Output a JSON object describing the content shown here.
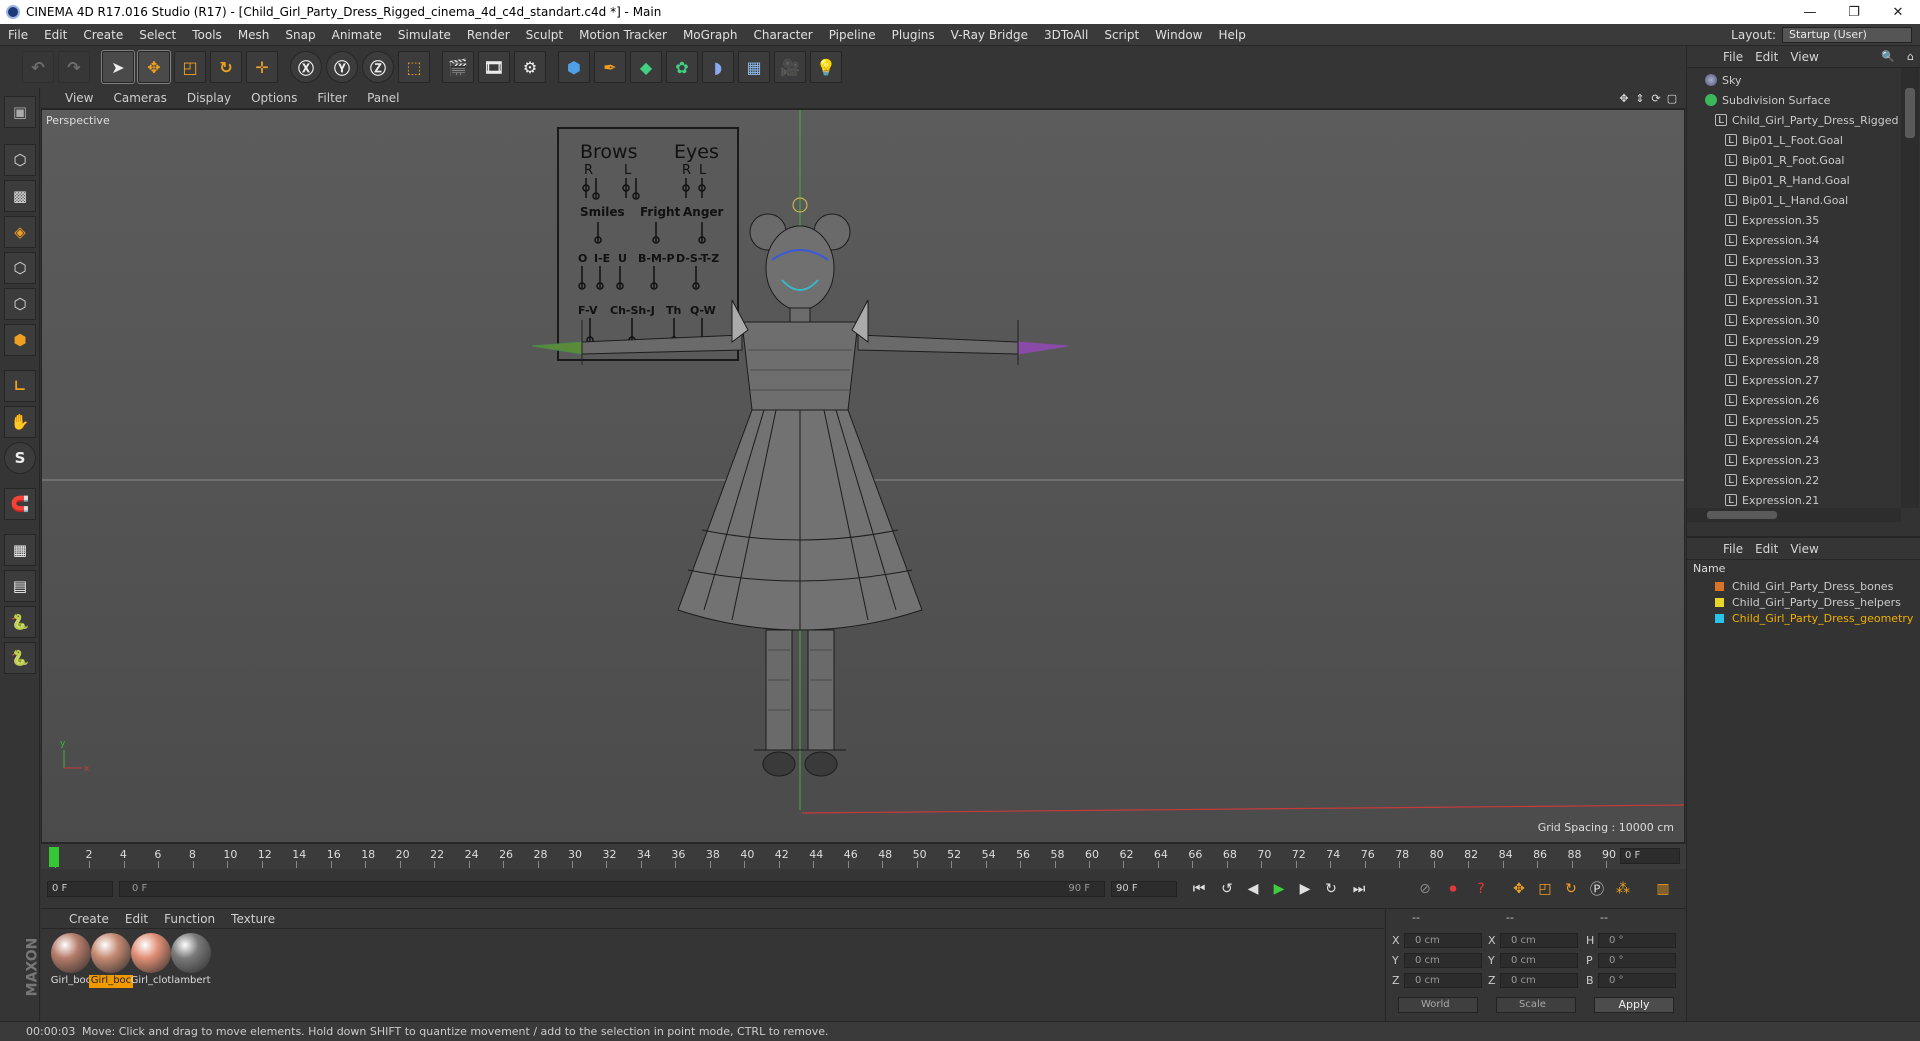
{
  "title": "CINEMA 4D R17.016 Studio (R17) - [Child_Girl_Party_Dress_Rigged_cinema_4d_c4d_standart.c4d *] - Main",
  "window_buttons": [
    "—",
    "❐",
    "✕"
  ],
  "menu": [
    "File",
    "Edit",
    "Create",
    "Select",
    "Tools",
    "Mesh",
    "Snap",
    "Animate",
    "Simulate",
    "Render",
    "Sculpt",
    "Motion Tracker",
    "MoGraph",
    "Character",
    "Pipeline",
    "Plugins",
    "V-Ray Bridge",
    "3DToAll",
    "Script",
    "Window",
    "Help"
  ],
  "layout": {
    "label": "Layout:",
    "value": "Startup (User)"
  },
  "viewport": {
    "menu": [
      "View",
      "Cameras",
      "Display",
      "Options",
      "Filter",
      "Panel"
    ],
    "label": "Perspective",
    "grid_spacing": "Grid Spacing : 10000 cm",
    "axis_y": "y",
    "axis_x": "x",
    "board": {
      "brows": "Brows",
      "eyes": "Eyes",
      "r1": "R",
      "l1": "L",
      "r2": "R",
      "l2": "L",
      "smiles": "Smiles",
      "fright": "Fright",
      "anger": "Anger",
      "o": "O",
      "ie": "I-E",
      "u": "U",
      "bmp": "B-M-P",
      "dstz": "D-S-T-Z",
      "fv": "F-V",
      "chshj": "Ch-Sh-J",
      "th": "Th",
      "qw": "Q-W"
    }
  },
  "timeline": {
    "ticks": [
      "0",
      "2",
      "4",
      "6",
      "8",
      "10",
      "12",
      "14",
      "16",
      "18",
      "20",
      "22",
      "24",
      "26",
      "28",
      "30",
      "32",
      "34",
      "36",
      "38",
      "40",
      "42",
      "44",
      "46",
      "48",
      "50",
      "52",
      "54",
      "56",
      "58",
      "60",
      "62",
      "64",
      "66",
      "68",
      "70",
      "72",
      "74",
      "76",
      "78",
      "80",
      "82",
      "84",
      "86",
      "88",
      "90"
    ],
    "current_frame": "0 F"
  },
  "transport": {
    "start": "0 F",
    "range_start": "0 F",
    "range_end": "90 F",
    "end": "90 F"
  },
  "materials": {
    "menu": [
      "Create",
      "Edit",
      "Function",
      "Texture"
    ],
    "items": [
      {
        "label": "Girl_boc",
        "color": "#b67c6a",
        "selected": false
      },
      {
        "label": "Girl_boc",
        "color": "#c58a72",
        "selected": true
      },
      {
        "label": "Girl_clot",
        "color": "#e08f76",
        "selected": false
      },
      {
        "label": "lambert",
        "color": "#7a7a7a",
        "selected": false
      }
    ]
  },
  "coords": {
    "headers": [
      "--",
      "--",
      "--"
    ],
    "x": "X",
    "y": "Y",
    "z": "Z",
    "x2": "X",
    "y2": "Y",
    "z2": "Z",
    "h": "H",
    "p": "P",
    "b": "B",
    "pos_x": "0 cm",
    "pos_y": "0 cm",
    "pos_z": "0 cm",
    "size_x": "0 cm",
    "size_y": "0 cm",
    "size_z": "0 cm",
    "rot_h": "0 °",
    "rot_p": "0 °",
    "rot_b": "0 °",
    "mode1": "World",
    "mode2": "Scale",
    "apply": "Apply"
  },
  "status": {
    "time": "00:00:03",
    "message": "Move: Click and drag to move elements. Hold down SHIFT to quantize movement / add to the selection in point mode, CTRL to remove."
  },
  "objects": {
    "menu": [
      "File",
      "Edit",
      "View"
    ],
    "items": [
      "Sky",
      "Subdivision Surface",
      "Child_Girl_Party_Dress_Rigged",
      "Bip01_L_Foot.Goal",
      "Bip01_R_Foot.Goal",
      "Bip01_R_Hand.Goal",
      "Bip01_L_Hand.Goal",
      "Expression.35",
      "Expression.34",
      "Expression.33",
      "Expression.32",
      "Expression.31",
      "Expression.30",
      "Expression.29",
      "Expression.28",
      "Expression.27",
      "Expression.26",
      "Expression.25",
      "Expression.24",
      "Expression.23",
      "Expression.22",
      "Expression.21"
    ]
  },
  "layers": {
    "menu": [
      "File",
      "Edit",
      "View"
    ],
    "header": "Name",
    "items": [
      {
        "label": "Child_Girl_Party_Dress_bones",
        "color": "#d8742a"
      },
      {
        "label": "Child_Girl_Party_Dress_helpers",
        "color": "#e8d52a"
      },
      {
        "label": "Child_Girl_Party_Dress_geometry",
        "color": "#2ac3e8"
      }
    ]
  },
  "colors": {
    "accent": "#f09a00",
    "geometry_text": "#f0b000"
  }
}
